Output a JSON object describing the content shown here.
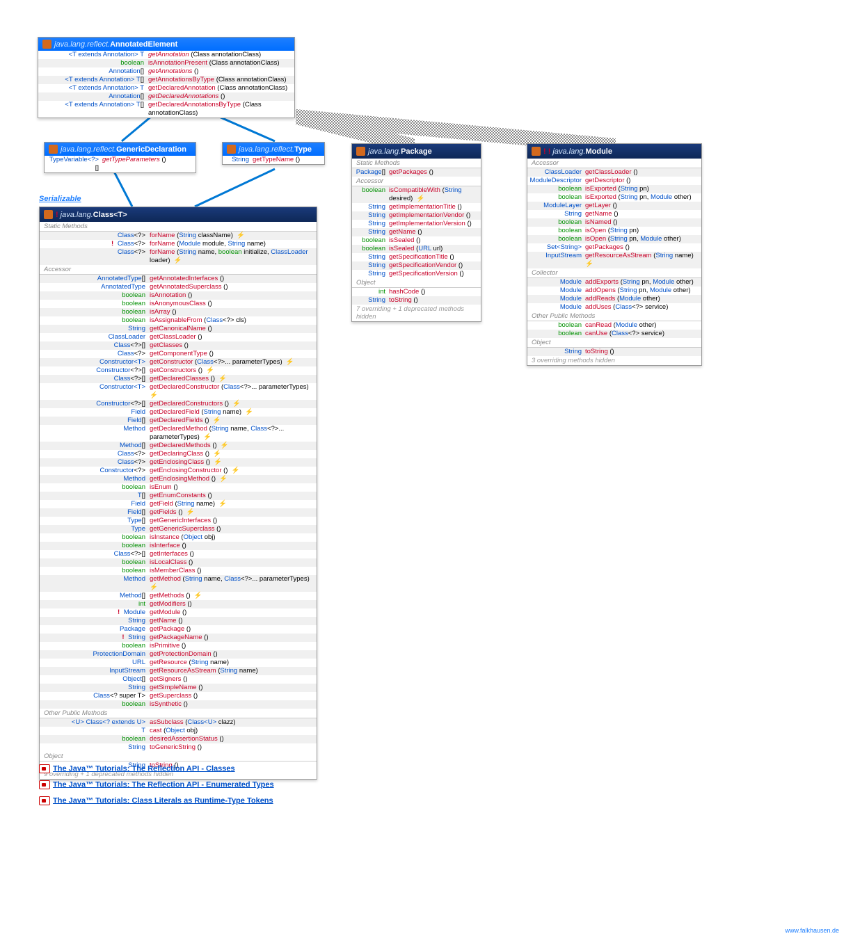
{
  "annEl": {
    "pkg": "java.lang.reflect.",
    "name": "AnnotatedElement",
    "rows": [
      {
        "ret": "<span class='tp'>&lt;T extends Annotation&gt; T</span>",
        "m": "getAnnotation",
        "mi": 1,
        "p": "(Class<T> annotationClass)"
      },
      {
        "ret": "<span class='kw'>boolean</span>",
        "m": "isAnnotationPresent",
        "p": "(Class<? extends Annotation> annotationClass)"
      },
      {
        "ret": "<span class='tp'>Annotation</span>[]",
        "m": "getAnnotations",
        "mi": 1,
        "p": "()"
      },
      {
        "ret": "<span class='tp'>&lt;T extends Annotation&gt; T</span>[]",
        "m": "getAnnotationsByType",
        "p": "(Class<T> annotationClass)"
      },
      {
        "ret": "<span class='tp'>&lt;T extends Annotation&gt; T</span>",
        "m": "getDeclaredAnnotation",
        "p": "(Class<T> annotationClass)"
      },
      {
        "ret": "<span class='tp'>Annotation</span>[]",
        "m": "getDeclaredAnnotations",
        "mi": 1,
        "p": "()"
      },
      {
        "ret": "<span class='tp'>&lt;T extends Annotation&gt; T</span>[]",
        "m": "getDeclaredAnnotationsByType",
        "p": "(Class<T> annotationClass)"
      }
    ]
  },
  "genDec": {
    "pkg": "java.lang.reflect.",
    "name": "GenericDeclaration",
    "rows": [
      {
        "ret": "<span class='tp'>TypeVariable&lt;?&gt;</span> []",
        "m": "getTypeParameters",
        "mi": 1,
        "p": "()"
      }
    ]
  },
  "type": {
    "pkg": "java.lang.reflect.",
    "name": "Type",
    "rows": [
      {
        "ret": "<span class='tp'>String</span>",
        "m": "getTypeName",
        "p": "()"
      }
    ]
  },
  "serializable": "Serializable",
  "cls": {
    "pkg": "java.lang.",
    "name": "Class",
    "tp": "<T>",
    "sects": [
      {
        "h": "Static Methods",
        "rows": [
          {
            "ret": "<span class='tp'>Class</span>&lt;?&gt;",
            "m": "forName",
            "p": "(<span class='tp'>String</span> className) <span class='ex'>&zwnj;</span>",
            "ex": 1
          },
          {
            "new": 1,
            "ret": "<span class='tp'>Class</span>&lt;?&gt;",
            "m": "forName",
            "p": "(<span class='tp'>Module</span> module, <span class='tp'>String</span> name)"
          },
          {
            "ret": "<span class='tp'>Class</span>&lt;?&gt;",
            "m": "forName",
            "p": "(<span class='tp'>String</span> name, <span class='kw'>boolean</span> initialize, <span class='tp'>ClassLoader</span> loader) <span class='ex'>&zwnj;</span>",
            "ex": 1
          }
        ]
      },
      {
        "h": "Accessor",
        "rows": [
          {
            "ret": "<span class='tp'>AnnotatedType</span>[]",
            "m": "getAnnotatedInterfaces",
            "p": "()"
          },
          {
            "ret": "<span class='tp'>AnnotatedType</span>",
            "m": "getAnnotatedSuperclass",
            "p": "()"
          },
          {
            "ret": "<span class='kw'>boolean</span>",
            "m": "isAnnotation",
            "p": "()"
          },
          {
            "ret": "<span class='kw'>boolean</span>",
            "m": "isAnonymousClass",
            "p": "()"
          },
          {
            "ret": "<span class='kw'>boolean</span>",
            "m": "isArray",
            "p": "()"
          },
          {
            "ret": "<span class='kw'>boolean</span>",
            "m": "isAssignableFrom",
            "p": "(<span class='tp'>Class</span>&lt;?&gt; cls)"
          },
          {
            "ret": "<span class='tp'>String</span>",
            "m": "getCanonicalName",
            "p": "()"
          },
          {
            "ret": "<span class='tp'>ClassLoader</span>",
            "m": "getClassLoader",
            "p": "()"
          },
          {
            "ret": "<span class='tp'>Class</span>&lt;?&gt;[]",
            "m": "getClasses",
            "p": "()"
          },
          {
            "ret": "<span class='tp'>Class</span>&lt;?&gt;",
            "m": "getComponentType",
            "p": "()"
          },
          {
            "ret": "<span class='tp'>Constructor&lt;T&gt;</span>",
            "m": "getConstructor",
            "p": "(<span class='tp'>Class</span>&lt;?&gt;... parameterTypes) <span class='ex'>&zwnj;</span>",
            "ex": 1
          },
          {
            "ret": "<span class='tp'>Constructor</span>&lt;?&gt;[]",
            "m": "getConstructors",
            "p": "() <span class='ex'>&zwnj;</span>",
            "ex": 1
          },
          {
            "ret": "<span class='tp'>Class</span>&lt;?&gt;[]",
            "m": "getDeclaredClasses",
            "p": "() <span class='ex'>&zwnj;</span>",
            "ex": 1
          },
          {
            "ret": "<span class='tp'>Constructor&lt;T&gt;</span>",
            "m": "getDeclaredConstructor",
            "p": "(<span class='tp'>Class</span>&lt;?&gt;... parameterTypes) <span class='ex'>&zwnj;</span>",
            "ex": 1
          },
          {
            "ret": "<span class='tp'>Constructor</span>&lt;?&gt;[]",
            "m": "getDeclaredConstructors",
            "p": "() <span class='ex'>&zwnj;</span>",
            "ex": 1
          },
          {
            "ret": "<span class='tp'>Field</span>",
            "m": "getDeclaredField",
            "p": "(<span class='tp'>String</span> name) <span class='ex'>&zwnj;</span>",
            "ex": 1
          },
          {
            "ret": "<span class='tp'>Field</span>[]",
            "m": "getDeclaredFields",
            "p": "() <span class='ex'>&zwnj;</span>",
            "ex": 1
          },
          {
            "ret": "<span class='tp'>Method</span>",
            "m": "getDeclaredMethod",
            "p": "(<span class='tp'>String</span> name, <span class='tp'>Class</span>&lt;?&gt;... parameterTypes) <span class='ex'>&zwnj;</span>",
            "ex": 1
          },
          {
            "ret": "<span class='tp'>Method</span>[]",
            "m": "getDeclaredMethods",
            "p": "() <span class='ex'>&zwnj;</span>",
            "ex": 1
          },
          {
            "ret": "<span class='tp'>Class</span>&lt;?&gt;",
            "m": "getDeclaringClass",
            "p": "() <span class='ex'>&zwnj;</span>",
            "ex": 1
          },
          {
            "ret": "<span class='tp'>Class</span>&lt;?&gt;",
            "m": "getEnclosingClass",
            "p": "() <span class='ex'>&zwnj;</span>",
            "ex": 1
          },
          {
            "ret": "<span class='tp'>Constructor</span>&lt;?&gt;",
            "m": "getEnclosingConstructor",
            "p": "() <span class='ex'>&zwnj;</span>",
            "ex": 1
          },
          {
            "ret": "<span class='tp'>Method</span>",
            "m": "getEnclosingMethod",
            "p": "() <span class='ex'>&zwnj;</span>",
            "ex": 1
          },
          {
            "ret": "<span class='kw'>boolean</span>",
            "m": "isEnum",
            "p": "()"
          },
          {
            "ret": "<span class='tp'>T</span>[]",
            "m": "getEnumConstants",
            "p": "()"
          },
          {
            "ret": "<span class='tp'>Field</span>",
            "m": "getField",
            "p": "(<span class='tp'>String</span> name) <span class='ex'>&zwnj;</span>",
            "ex": 1
          },
          {
            "ret": "<span class='tp'>Field</span>[]",
            "m": "getFields",
            "p": "() <span class='ex'>&zwnj;</span>",
            "ex": 1
          },
          {
            "ret": "<span class='tp'>Type</span>[]",
            "m": "getGenericInterfaces",
            "p": "()"
          },
          {
            "ret": "<span class='tp'>Type</span>",
            "m": "getGenericSuperclass",
            "p": "()"
          },
          {
            "ret": "<span class='kw'>boolean</span>",
            "m": "isInstance",
            "p": "(<span class='tp'>Object</span> obj)"
          },
          {
            "ret": "<span class='kw'>boolean</span>",
            "m": "isInterface",
            "p": "()"
          },
          {
            "ret": "<span class='tp'>Class</span>&lt;?&gt;[]",
            "m": "getInterfaces",
            "p": "()"
          },
          {
            "ret": "<span class='kw'>boolean</span>",
            "m": "isLocalClass",
            "p": "()"
          },
          {
            "ret": "<span class='kw'>boolean</span>",
            "m": "isMemberClass",
            "p": "()"
          },
          {
            "ret": "<span class='tp'>Method</span>",
            "m": "getMethod",
            "p": "(<span class='tp'>String</span> name, <span class='tp'>Class</span>&lt;?&gt;... parameterTypes) <span class='ex'>&zwnj;</span>",
            "ex": 1
          },
          {
            "ret": "<span class='tp'>Method</span>[]",
            "m": "getMethods",
            "p": "() <span class='ex'>&zwnj;</span>",
            "ex": 1
          },
          {
            "ret": "<span class='kw'>int</span>",
            "m": "getModifiers",
            "p": "()"
          },
          {
            "new": 1,
            "ret": "<span class='tp'>Module</span>",
            "m": "getModule",
            "p": "()"
          },
          {
            "ret": "<span class='tp'>String</span>",
            "m": "getName",
            "p": "()"
          },
          {
            "ret": "<span class='tp'>Package</span>",
            "m": "getPackage",
            "p": "()"
          },
          {
            "new": 1,
            "ret": "<span class='tp'>String</span>",
            "m": "getPackageName",
            "p": "()"
          },
          {
            "ret": "<span class='kw'>boolean</span>",
            "m": "isPrimitive",
            "p": "()"
          },
          {
            "ret": "<span class='tp'>ProtectionDomain</span>",
            "m": "getProtectionDomain",
            "p": "()"
          },
          {
            "ret": "<span class='tp'>URL</span>",
            "m": "getResource",
            "p": "(<span class='tp'>String</span> name)"
          },
          {
            "ret": "<span class='tp'>InputStream</span>",
            "m": "getResourceAsStream",
            "p": "(<span class='tp'>String</span> name)"
          },
          {
            "ret": "<span class='tp'>Object</span>[]",
            "m": "getSigners",
            "p": "()"
          },
          {
            "ret": "<span class='tp'>String</span>",
            "m": "getSimpleName",
            "p": "()"
          },
          {
            "ret": "<span class='tp'>Class</span>&lt;? super T&gt;",
            "m": "getSuperclass",
            "p": "()"
          },
          {
            "ret": "<span class='kw'>boolean</span>",
            "m": "isSynthetic",
            "p": "()"
          }
        ]
      },
      {
        "h": "Other Public Methods",
        "rows": [
          {
            "ret": "<span class='tp'>&lt;U&gt; Class&lt;? extends U&gt;</span>",
            "m": "asSubclass",
            "p": "(<span class='tp'>Class&lt;U&gt;</span> clazz)"
          },
          {
            "ret": "<span class='tp'>T</span>",
            "m": "cast",
            "p": "(<span class='tp'>Object</span> obj)"
          },
          {
            "ret": "<span class='kw'>boolean</span>",
            "m": "desiredAssertionStatus",
            "p": "()"
          },
          {
            "ret": "<span class='tp'>String</span>",
            "m": "toGenericString",
            "p": "()"
          }
        ]
      },
      {
        "h": "Object",
        "rows": [
          {
            "ret": "<span class='tp'>String</span>",
            "m": "toString",
            "p": "()"
          }
        ]
      }
    ],
    "note": "9 overriding + 1 deprecated methods hidden"
  },
  "pkgBox": {
    "pkg": "java.lang.",
    "name": "Package",
    "sects": [
      {
        "h": "Static Methods",
        "rows": [
          {
            "ret": "<span class='tp'>Package</span>[]",
            "m": "getPackages",
            "p": "()"
          }
        ]
      },
      {
        "h": "Accessor",
        "rows": [
          {
            "ret": "<span class='kw'>boolean</span>",
            "m": "isCompatibleWith",
            "p": "(<span class='tp'>String</span> desired) <span class='ex'>&zwnj;</span>",
            "ex": 1
          },
          {
            "ret": "<span class='tp'>String</span>",
            "m": "getImplementationTitle",
            "p": "()"
          },
          {
            "ret": "<span class='tp'>String</span>",
            "m": "getImplementationVendor",
            "p": "()"
          },
          {
            "ret": "<span class='tp'>String</span>",
            "m": "getImplementationVersion",
            "p": "()"
          },
          {
            "ret": "<span class='tp'>String</span>",
            "m": "getName",
            "p": "()"
          },
          {
            "ret": "<span class='kw'>boolean</span>",
            "m": "isSealed",
            "p": "()"
          },
          {
            "ret": "<span class='kw'>boolean</span>",
            "m": "isSealed",
            "p": "(<span class='tp'>URL</span> url)"
          },
          {
            "ret": "<span class='tp'>String</span>",
            "m": "getSpecificationTitle",
            "p": "()"
          },
          {
            "ret": "<span class='tp'>String</span>",
            "m": "getSpecificationVendor",
            "p": "()"
          },
          {
            "ret": "<span class='tp'>String</span>",
            "m": "getSpecificationVersion",
            "p": "()"
          }
        ]
      },
      {
        "h": "Object",
        "rows": [
          {
            "ret": "<span class='kw'>int</span>",
            "m": "hashCode",
            "p": "()"
          },
          {
            "ret": "<span class='tp'>String</span>",
            "m": "toString",
            "p": "()"
          }
        ]
      }
    ],
    "note": "7 overriding + 1 deprecated methods hidden"
  },
  "mod": {
    "pkg": "java.lang.",
    "name": "Module",
    "sects": [
      {
        "h": "Accessor",
        "rows": [
          {
            "ret": "<span class='tp'>ClassLoader</span>",
            "m": "getClassLoader",
            "p": "()"
          },
          {
            "ret": "<span class='tp'>ModuleDescriptor</span>",
            "m": "getDescriptor",
            "p": "()"
          },
          {
            "ret": "<span class='kw'>boolean</span>",
            "m": "isExported",
            "p": "(<span class='tp'>String</span> pn)"
          },
          {
            "ret": "<span class='kw'>boolean</span>",
            "m": "isExported",
            "p": "(<span class='tp'>String</span> pn, <span class='tp'>Module</span> other)"
          },
          {
            "ret": "<span class='tp'>ModuleLayer</span>",
            "m": "getLayer",
            "p": "()"
          },
          {
            "ret": "<span class='tp'>String</span>",
            "m": "getName",
            "p": "()"
          },
          {
            "ret": "<span class='kw'>boolean</span>",
            "m": "isNamed",
            "p": "()"
          },
          {
            "ret": "<span class='kw'>boolean</span>",
            "m": "isOpen",
            "p": "(<span class='tp'>String</span> pn)"
          },
          {
            "ret": "<span class='kw'>boolean</span>",
            "m": "isOpen",
            "p": "(<span class='tp'>String</span> pn, <span class='tp'>Module</span> other)"
          },
          {
            "ret": "<span class='tp'>Set&lt;String&gt;</span>",
            "m": "getPackages",
            "p": "()"
          },
          {
            "ret": "<span class='tp'>InputStream</span>",
            "m": "getResourceAsStream",
            "p": "(<span class='tp'>String</span> name) <span class='ex'>&zwnj;</span>",
            "ex": 1
          }
        ]
      },
      {
        "h": "Collector",
        "rows": [
          {
            "ret": "<span class='tp'>Module</span>",
            "m": "addExports",
            "p": "(<span class='tp'>String</span> pn, <span class='tp'>Module</span> other)"
          },
          {
            "ret": "<span class='tp'>Module</span>",
            "m": "addOpens",
            "p": "(<span class='tp'>String</span> pn, <span class='tp'>Module</span> other)"
          },
          {
            "ret": "<span class='tp'>Module</span>",
            "m": "addReads",
            "p": "(<span class='tp'>Module</span> other)"
          },
          {
            "ret": "<span class='tp'>Module</span>",
            "m": "addUses",
            "p": "(<span class='tp'>Class</span>&lt;?&gt; service)"
          }
        ]
      },
      {
        "h": "Other Public Methods",
        "rows": [
          {
            "ret": "<span class='kw'>boolean</span>",
            "m": "canRead",
            "p": "(<span class='tp'>Module</span> other)"
          },
          {
            "ret": "<span class='kw'>boolean</span>",
            "m": "canUse",
            "p": "(<span class='tp'>Class</span>&lt;?&gt; service)"
          }
        ]
      },
      {
        "h": "Object",
        "rows": [
          {
            "ret": "<span class='tp'>String</span>",
            "m": "toString",
            "p": "()"
          }
        ]
      }
    ],
    "note": "3 overriding methods hidden"
  },
  "links": [
    "The Java™ Tutorials: The Reflection API - Classes",
    "The Java™ Tutorials: The Reflection API - Enumerated Types",
    "The Java™ Tutorials: Class Literals as Runtime-Type Tokens"
  ],
  "credit": "www.falkhausen.de"
}
